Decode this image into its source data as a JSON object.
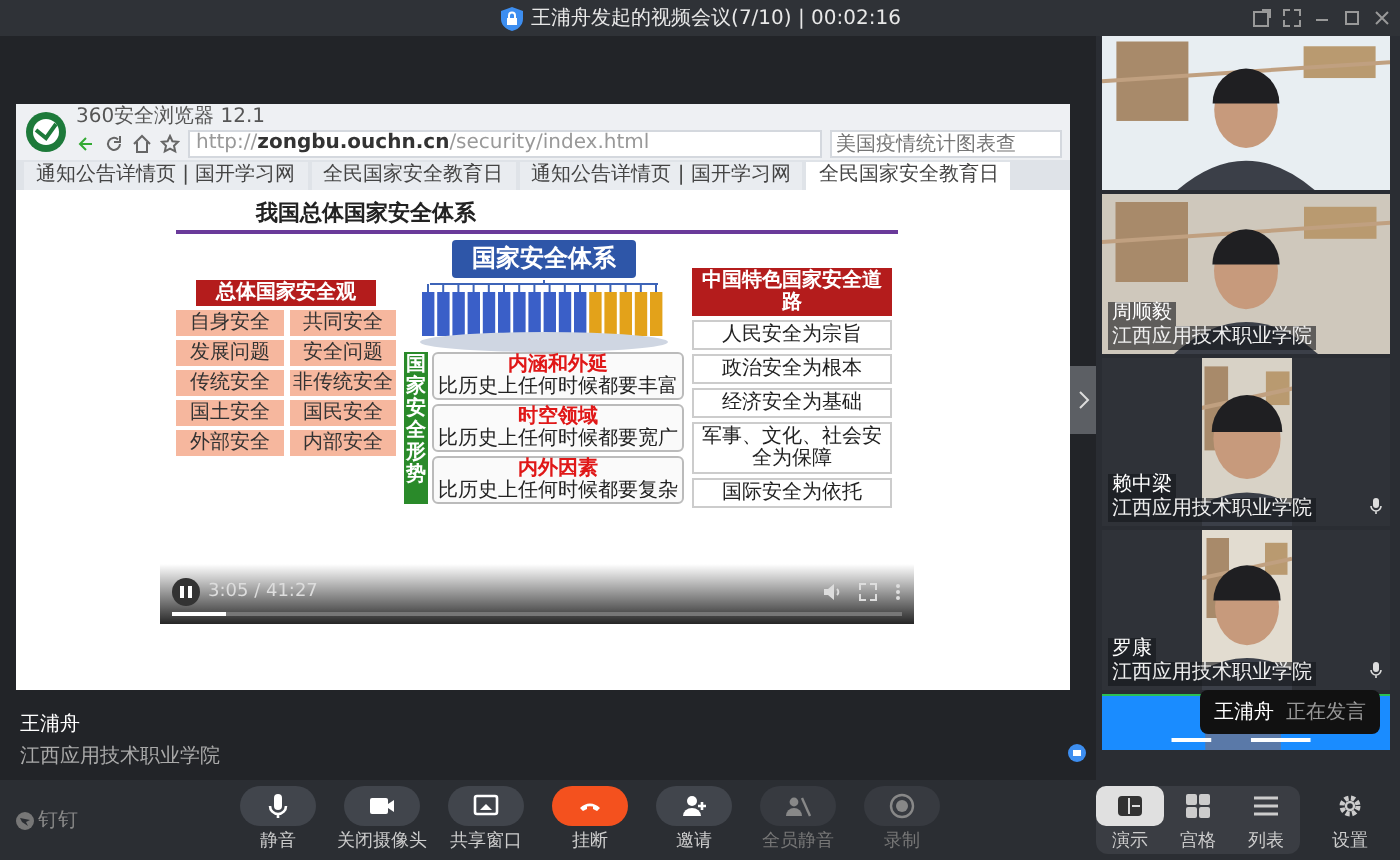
{
  "window": {
    "title": "王浦舟发起的视频会议(7/10) | 00:02:16"
  },
  "shared_screen": {
    "browser": {
      "app_title": "360安全浏览器 12.1",
      "url": "http://**zongbu.ouchn.cn**/security/index.html",
      "search_placeholder": "美国疫情统计图表查",
      "tabs": [
        {
          "label": "通知公告详情页 | 国开学习网",
          "selected": false
        },
        {
          "label": "全民国家安全教育日",
          "selected": false
        },
        {
          "label": "通知公告详情页 | 国开学习网",
          "selected": false
        },
        {
          "label": "全民国家安全教育日",
          "selected": true
        }
      ]
    },
    "slide": {
      "title": "我国总体国家安全体系",
      "center_header": "国家安全体系",
      "left_header": "总体国家安全观",
      "left_pairs": [
        [
          "自身安全",
          "共同安全"
        ],
        [
          "发展问题",
          "安全问题"
        ],
        [
          "传统安全",
          "非传统安全"
        ],
        [
          "国土安全",
          "国民安全"
        ],
        [
          "外部安全",
          "内部安全"
        ]
      ],
      "situation_label": "国家安全形势",
      "situation_items": [
        {
          "heading": "内涵和外延",
          "text": "比历史上任何时候都要丰富"
        },
        {
          "heading": "时空领域",
          "text": "比历史上任何时候都要宽广"
        },
        {
          "heading": "内外因素",
          "text": "比历史上任何时候都要复杂"
        }
      ],
      "right_header": "中国特色国家安全道路",
      "right_items": [
        "人民安全为宗旨",
        "政治安全为根本",
        "经济安全为基础",
        "军事、文化、社会安全为保障",
        "国际安全为依托"
      ]
    },
    "player": {
      "playing": true,
      "time": "3:05 / 41:27",
      "level": 0.074
    }
  },
  "presenter": {
    "name": "王浦舟",
    "org": "江西应用技术职业学院"
  },
  "participants": [
    {
      "kind": "wide_video",
      "mic": false
    },
    {
      "kind": "wide_video",
      "name": "周顺毅",
      "org": "江西应用技术职业学院",
      "mic": false
    },
    {
      "kind": "narrow_video",
      "name": "赖中梁",
      "org": "江西应用技术职业学院",
      "mic": true
    },
    {
      "kind": "narrow_video",
      "name": "罗康",
      "org": "江西应用技术职业学院",
      "mic": true
    },
    {
      "kind": "screen",
      "mic": false
    }
  ],
  "speaking_toast": {
    "name": "王浦舟",
    "status": "正在发言"
  },
  "toolbar": {
    "brand": "钉钉",
    "buttons": [
      {
        "kind": "mic",
        "label": "静音",
        "disabled": false
      },
      {
        "kind": "camera",
        "label": "关闭摄像头",
        "disabled": false
      },
      {
        "kind": "share",
        "label": "共享窗口",
        "disabled": false
      },
      {
        "kind": "hangup",
        "label": "挂断",
        "disabled": false
      },
      {
        "kind": "invite",
        "label": "邀请",
        "disabled": false
      },
      {
        "kind": "muteall",
        "label": "全员静音",
        "disabled": true
      },
      {
        "kind": "record",
        "label": "录制",
        "disabled": true
      }
    ],
    "views": [
      {
        "kind": "presentation",
        "label": "演示",
        "selected": true
      },
      {
        "kind": "grid",
        "label": "宫格",
        "selected": false
      },
      {
        "kind": "list",
        "label": "列表",
        "selected": false
      }
    ],
    "settings": "设置"
  }
}
